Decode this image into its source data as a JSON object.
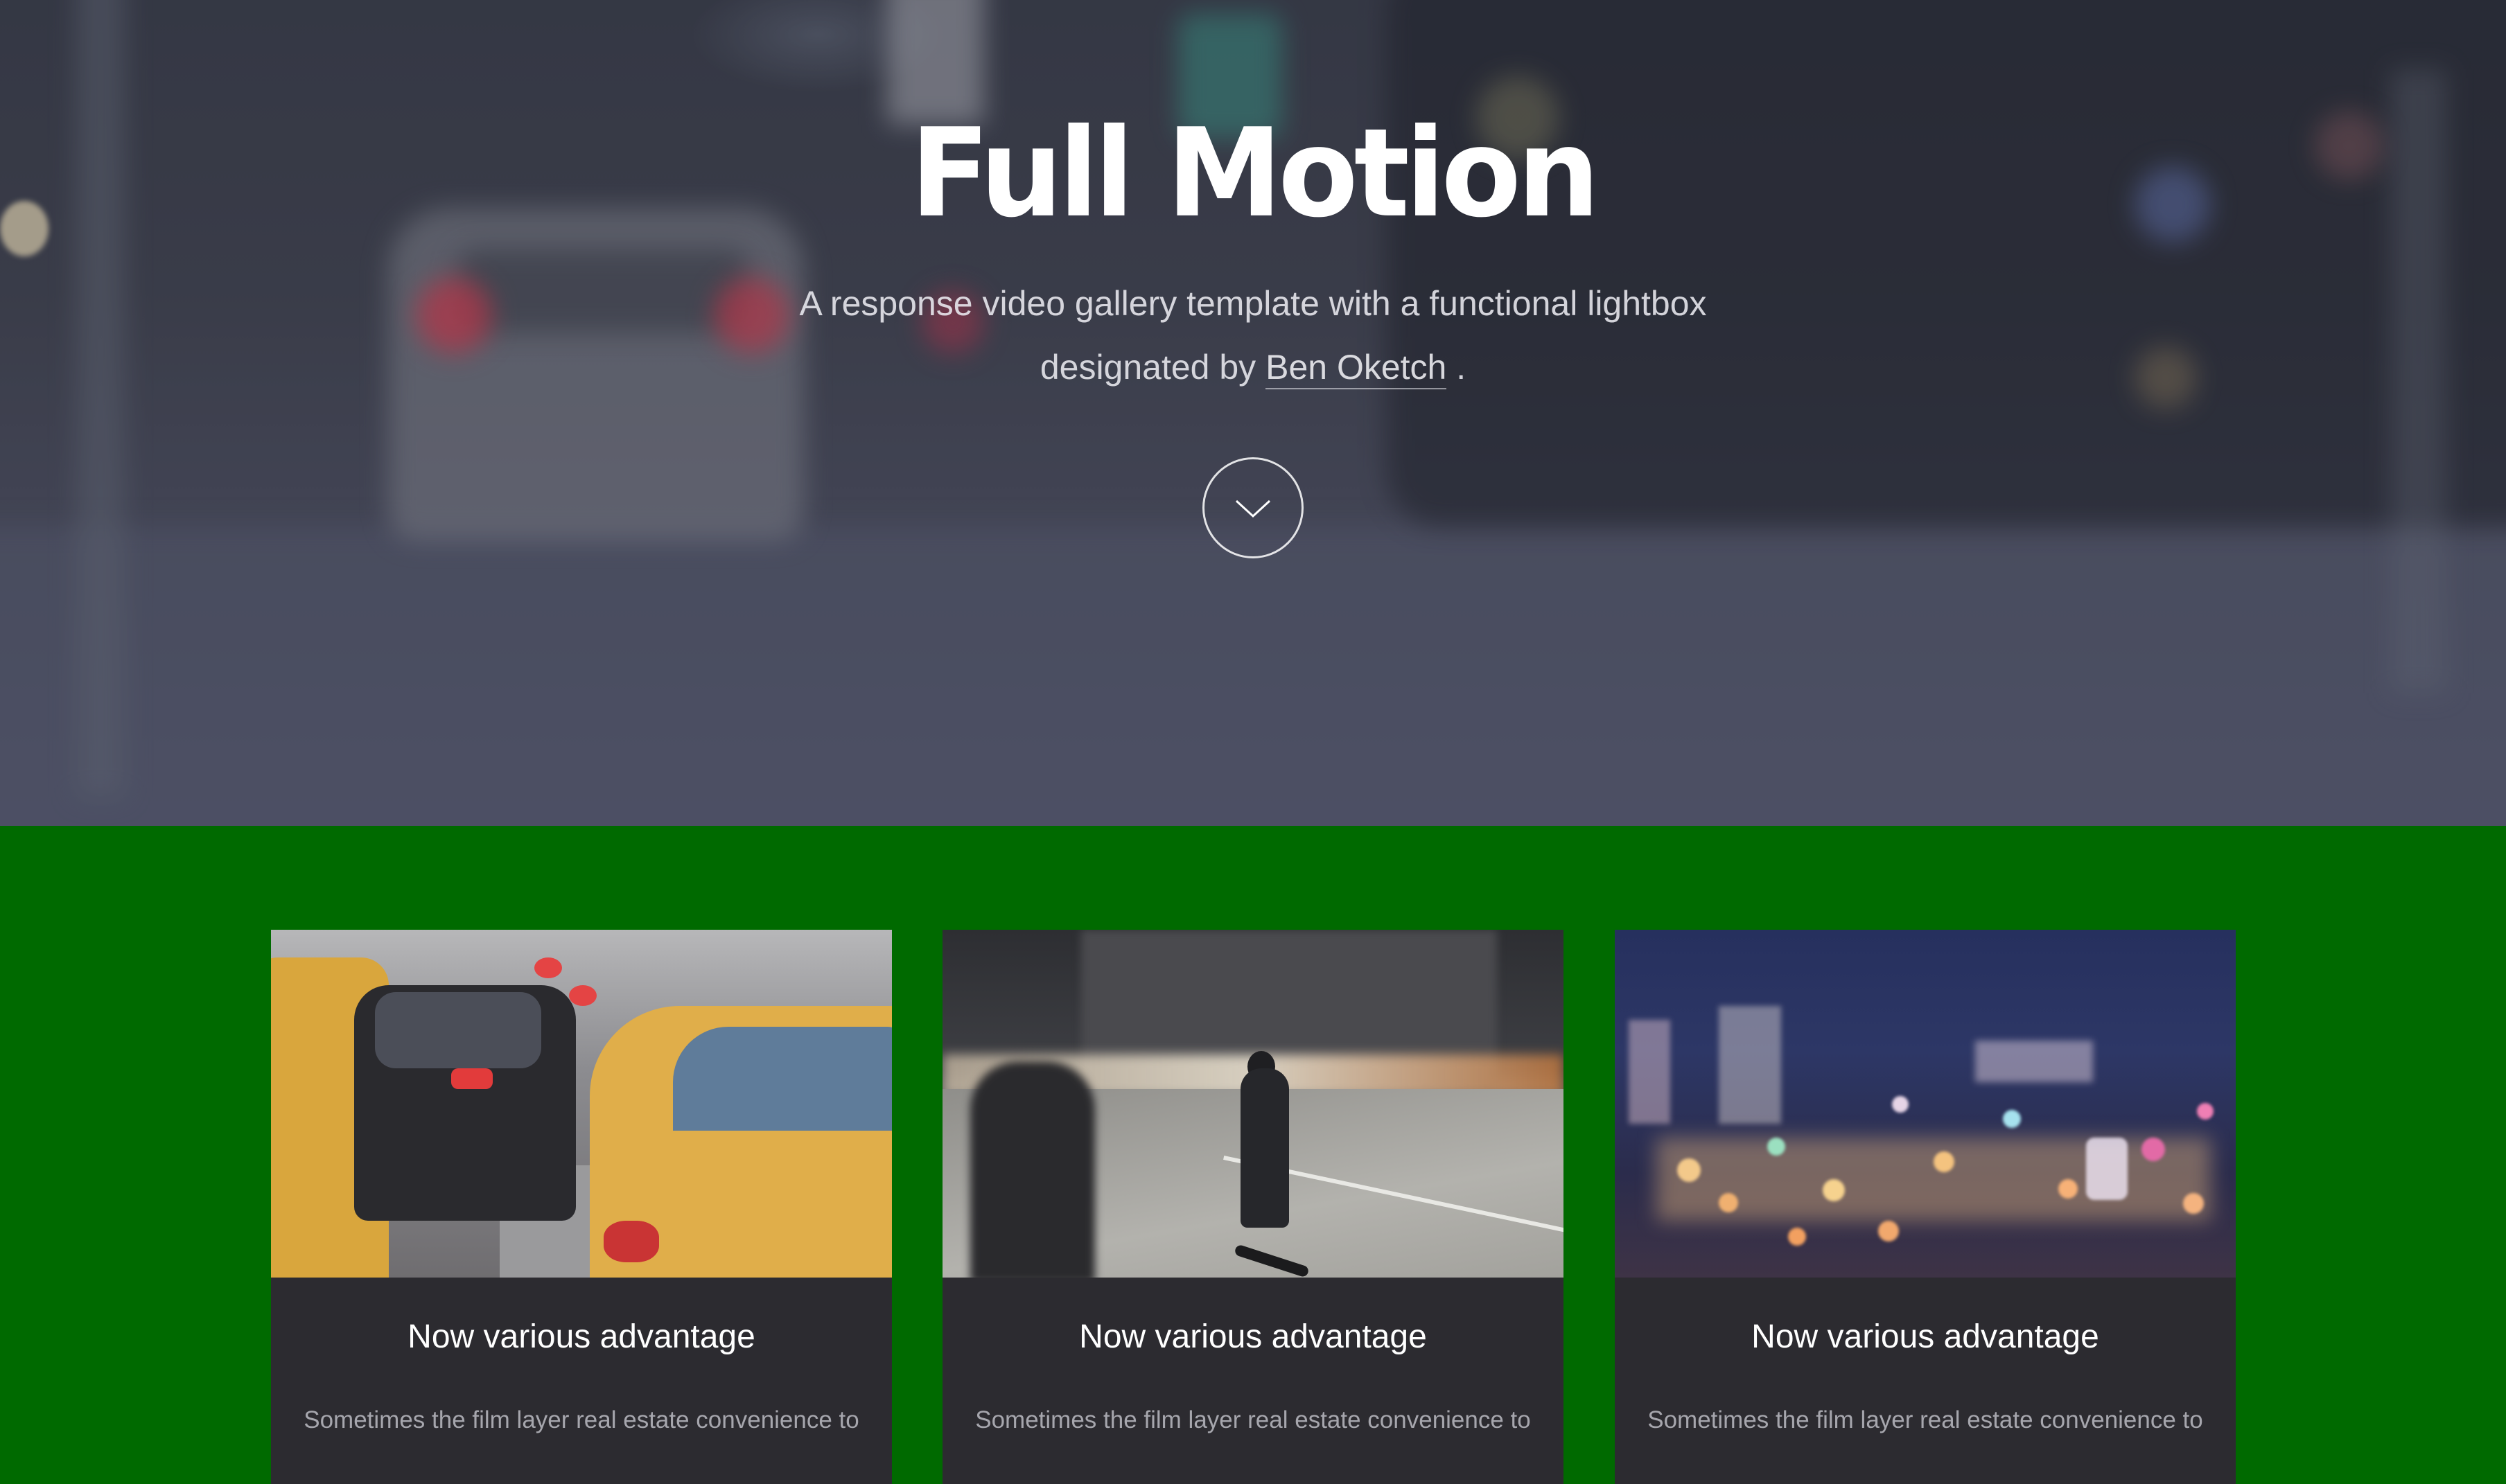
{
  "hero": {
    "title": "Full Motion",
    "subtitle_line1": "A response video gallery template with a functional lightbox",
    "subtitle_line2_prefix": "designated by",
    "author": "Ben Oketch",
    "subtitle_line2_suffix": ".",
    "scroll_icon": "chevron-down-icon"
  },
  "cards": [
    {
      "image": "taxis-traffic-photo",
      "title": "Now various advantage",
      "text": "Sometimes the film layer real estate convenience to"
    },
    {
      "image": "street-skater-photo",
      "title": "Now various advantage",
      "text": "Sometimes the film layer real estate convenience to"
    },
    {
      "image": "city-bokeh-photo",
      "title": "Now various advantage",
      "text": "Sometimes the film layer real estate convenience to"
    }
  ],
  "colors": {
    "background": "#006a00",
    "card_background": "#2c2b30",
    "card_title": "#ffffff",
    "card_text": "#a6a6ad"
  }
}
